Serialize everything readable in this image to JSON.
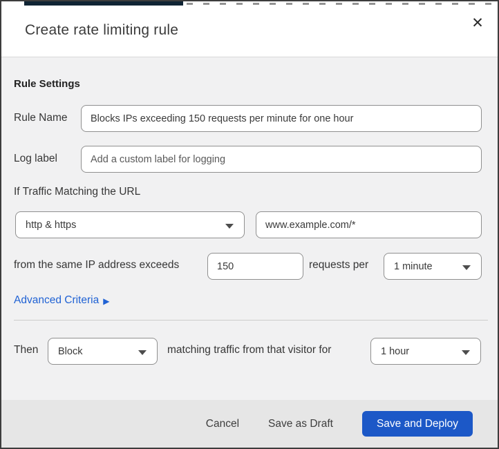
{
  "dialog": {
    "title": "Create rate limiting rule",
    "close_icon": "✕"
  },
  "rule_settings": {
    "heading": "Rule Settings",
    "rule_name": {
      "label": "Rule Name",
      "value": "Blocks IPs exceeding 150 requests per minute for one hour"
    },
    "log_label": {
      "label": "Log label",
      "placeholder": "Add a custom label for logging"
    },
    "traffic_match": {
      "label": "If Traffic Matching the URL",
      "scheme_selected": "http & https",
      "url_value": "www.example.com/*"
    },
    "threshold": {
      "prefix": "from the same IP address exceeds",
      "requests_value": "150",
      "middle": "requests per",
      "period_selected": "1 minute"
    },
    "advanced_criteria": {
      "label": "Advanced Criteria",
      "arrow": "▶"
    }
  },
  "action": {
    "then_label": "Then",
    "action_selected": "Block",
    "middle": "matching traffic from that visitor for",
    "duration_selected": "1 hour"
  },
  "footer": {
    "cancel": "Cancel",
    "save_draft": "Save as Draft",
    "save_deploy": "Save and Deploy"
  },
  "colors": {
    "link_blue": "#2062d4",
    "primary_button_blue": "#1c58c7",
    "body_background": "#f1f1f2",
    "footer_background": "#e6e6e6",
    "top_navy_bar": "#102434"
  }
}
